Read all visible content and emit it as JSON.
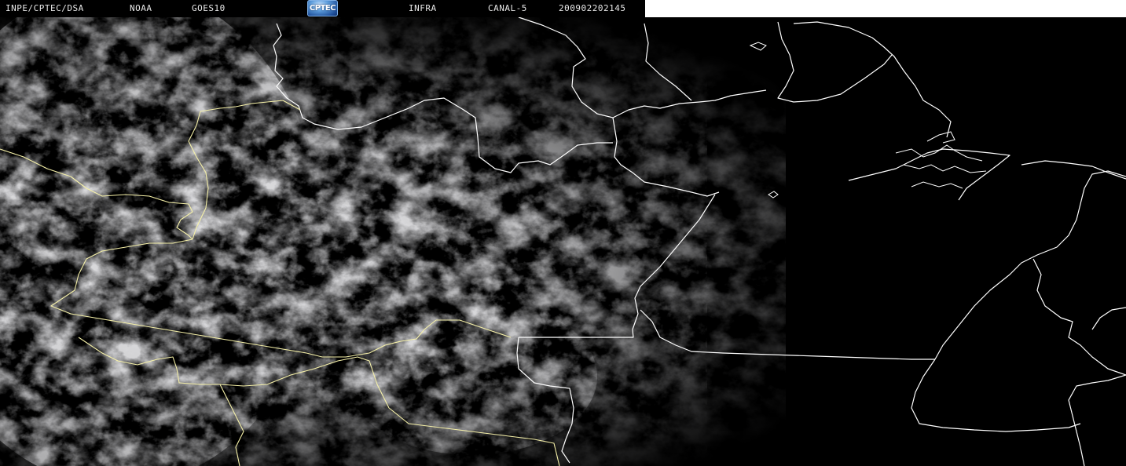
{
  "header": {
    "source": "INPE/CPTEC/DSA",
    "agency": "NOAA",
    "satellite": "GOES10",
    "logo_text": "CPTEC",
    "band": "INFRA",
    "channel": "CANAL-5",
    "timestamp": "200902202145"
  },
  "colors": {
    "background": "#000000",
    "header_text": "#e8e8e8",
    "border_white": "#ffffff",
    "border_yellow": "#f5f0a8",
    "cloud_gray": "#8a8a8a",
    "right_strip": "#ffffff"
  }
}
